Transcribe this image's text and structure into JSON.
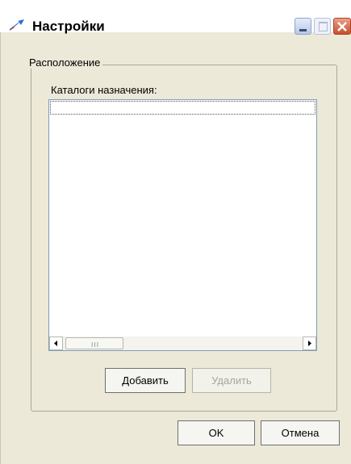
{
  "window": {
    "title": "Настройки",
    "icon": "settings-arrow-icon"
  },
  "titlebar_buttons": {
    "minimize_icon": "minimize-icon",
    "maximize_icon": "maximize-icon",
    "close_icon": "close-icon"
  },
  "location_group": {
    "label": "Расположение",
    "list_label": "Каталоги назначения:",
    "items": [],
    "scrollbar_grip": "III"
  },
  "buttons": {
    "add": "Добавить",
    "remove": "Удалить",
    "ok": "OK",
    "cancel": "Отмена"
  },
  "colors": {
    "dialog_bg": "#ece9d8",
    "close_red": "#c8502c",
    "list_border": "#7f9db9"
  }
}
